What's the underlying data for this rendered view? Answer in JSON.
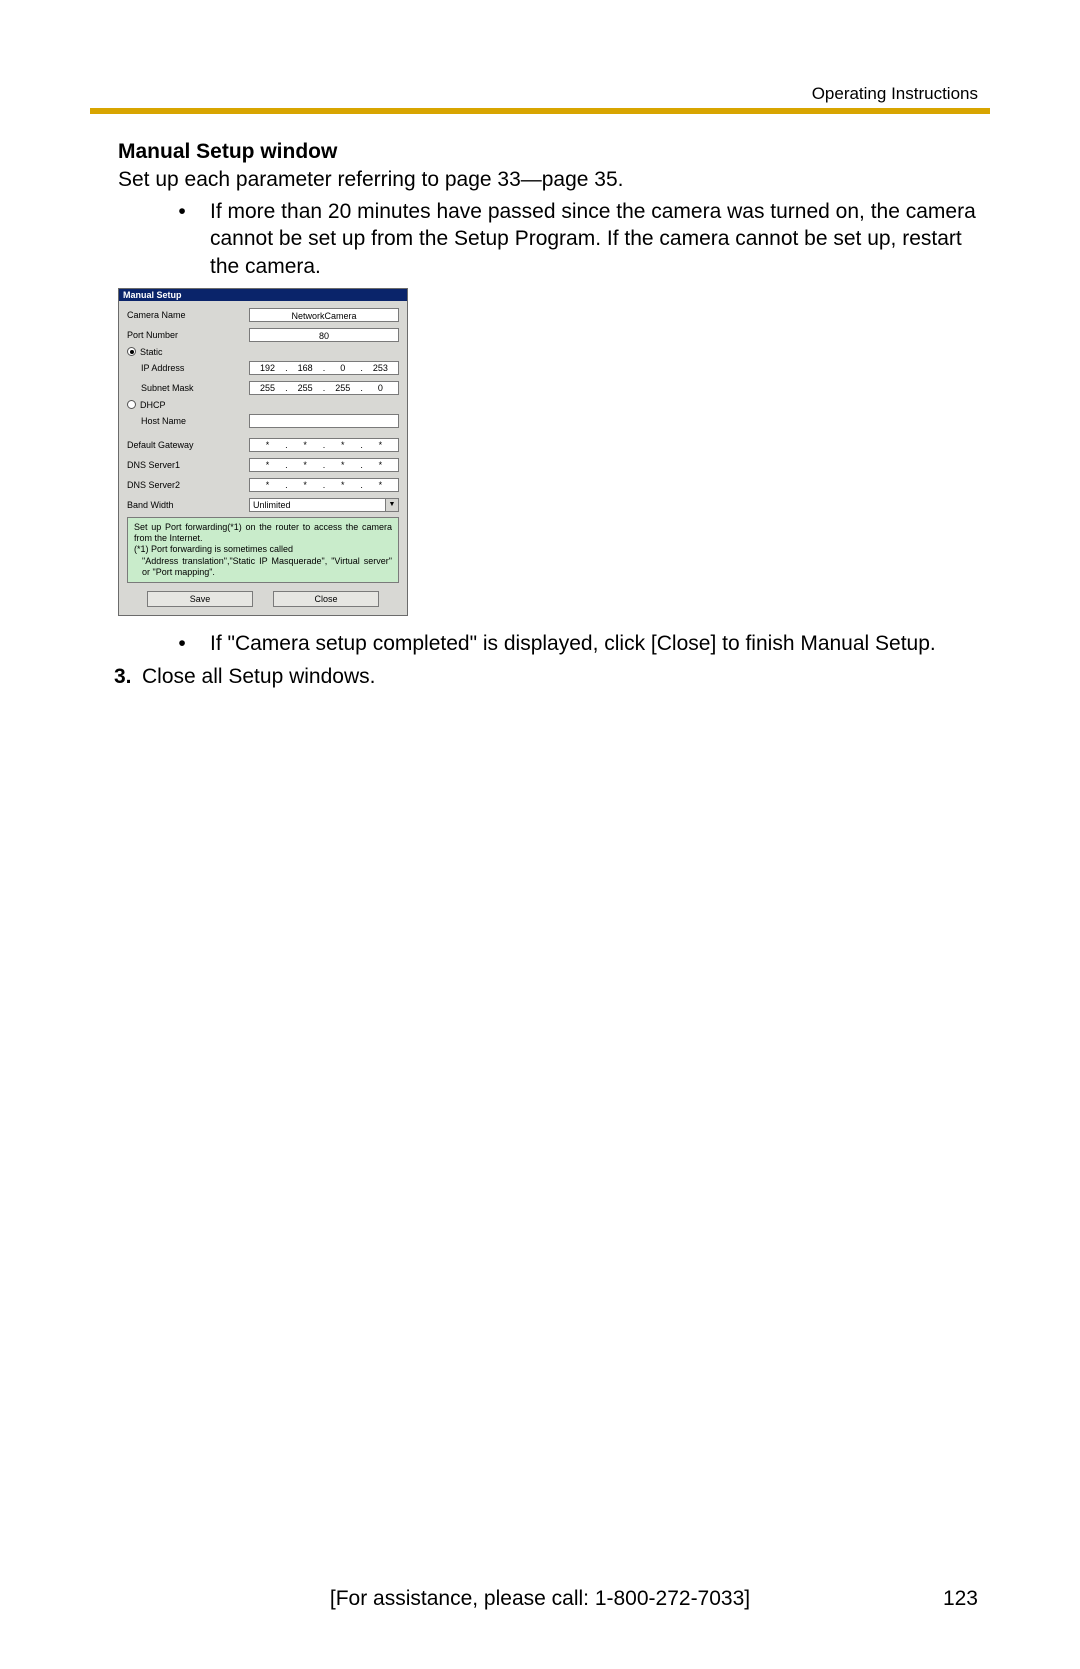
{
  "header": {
    "doc_label": "Operating Instructions"
  },
  "section": {
    "title": "Manual Setup window",
    "intro": "Set up each parameter referring to page 33—page 35.",
    "bullet1": "If more than 20 minutes have passed since the camera was turned on, the camera cannot be set up from the Setup Program. If the camera cannot be set up, restart the camera.",
    "bullet2": "If \"Camera setup completed\" is displayed, click [Close] to finish Manual Setup.",
    "step3_num": "3.",
    "step3_text": "Close all Setup windows."
  },
  "dialog": {
    "title": "Manual Setup",
    "labels": {
      "camera_name": "Camera Name",
      "port_number": "Port Number",
      "static": "Static",
      "ip_address": "IP Address",
      "subnet_mask": "Subnet Mask",
      "dhcp": "DHCP",
      "host_name": "Host Name",
      "default_gateway": "Default Gateway",
      "dns1": "DNS Server1",
      "dns2": "DNS Server2",
      "band_width": "Band Width"
    },
    "values": {
      "camera_name": "NetworkCamera",
      "port_number": "80",
      "ip": [
        "192",
        "168",
        "0",
        "253"
      ],
      "mask": [
        "255",
        "255",
        "255",
        "0"
      ],
      "host_name": "",
      "gw": [
        "*",
        "*",
        "*",
        "*"
      ],
      "dns1": [
        "*",
        "*",
        "*",
        "*"
      ],
      "dns2": [
        "*",
        "*",
        "*",
        "*"
      ],
      "band_width": "Unlimited"
    },
    "note_lines": [
      "Set up Port forwarding(*1) on the router to access the camera from the Internet.",
      "(*1) Port forwarding is sometimes called",
      "\"Address translation\",\"Static IP Masquerade\", \"Virtual server\" or \"Port mapping\"."
    ],
    "buttons": {
      "save": "Save",
      "close": "Close"
    }
  },
  "footer": {
    "assist": "[For assistance, please call: 1-800-272-7033]",
    "page": "123"
  }
}
